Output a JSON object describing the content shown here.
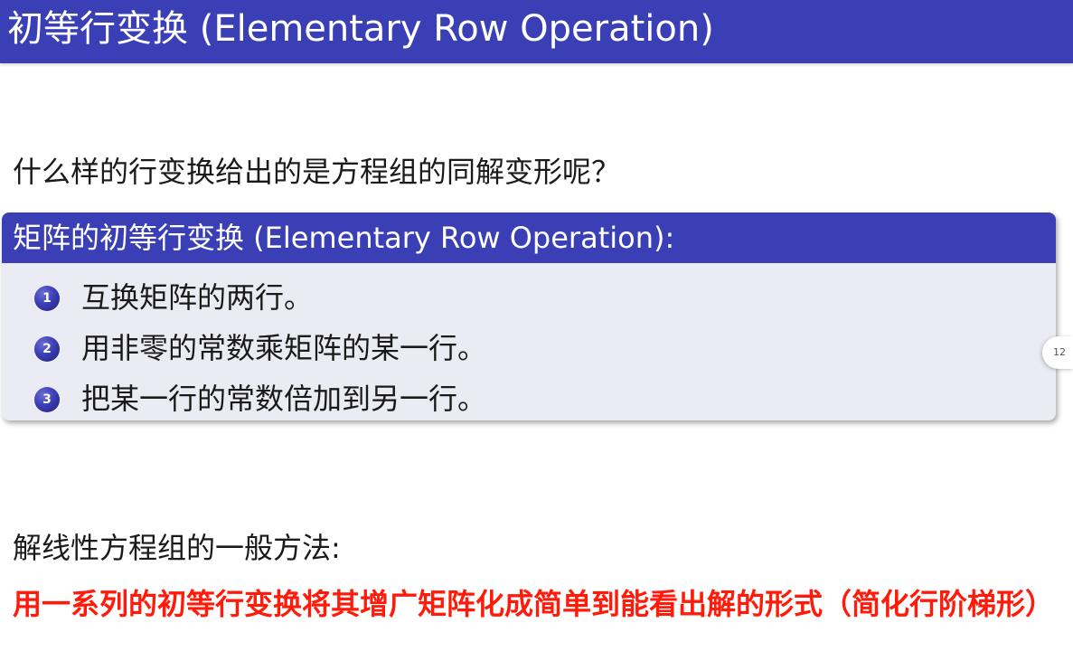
{
  "frame": {
    "title": "初等行变换 (Elementary Row Operation)"
  },
  "question": "什么样的行变换给出的是方程组的同解变形呢？",
  "block": {
    "title": "矩阵的初等行变换 (Elementary Row Operation):",
    "items": [
      {
        "marker": "1",
        "text": "互换矩阵的两行。"
      },
      {
        "marker": "2",
        "text": "用非零的常数乘矩阵的某一行。"
      },
      {
        "marker": "3",
        "text": "把某一行的常数倍加到另一行。"
      }
    ]
  },
  "method": {
    "label": "解线性方程组的一般方法:",
    "description": "用一系列的初等行变换将其增广矩阵化成简单到能看出解的形式（简化行阶梯形）"
  },
  "page": {
    "number": "12"
  },
  "colors": {
    "accent": "#3b3fb6",
    "highlight": "#ff1a0a",
    "block_body": "#ebebf4"
  }
}
